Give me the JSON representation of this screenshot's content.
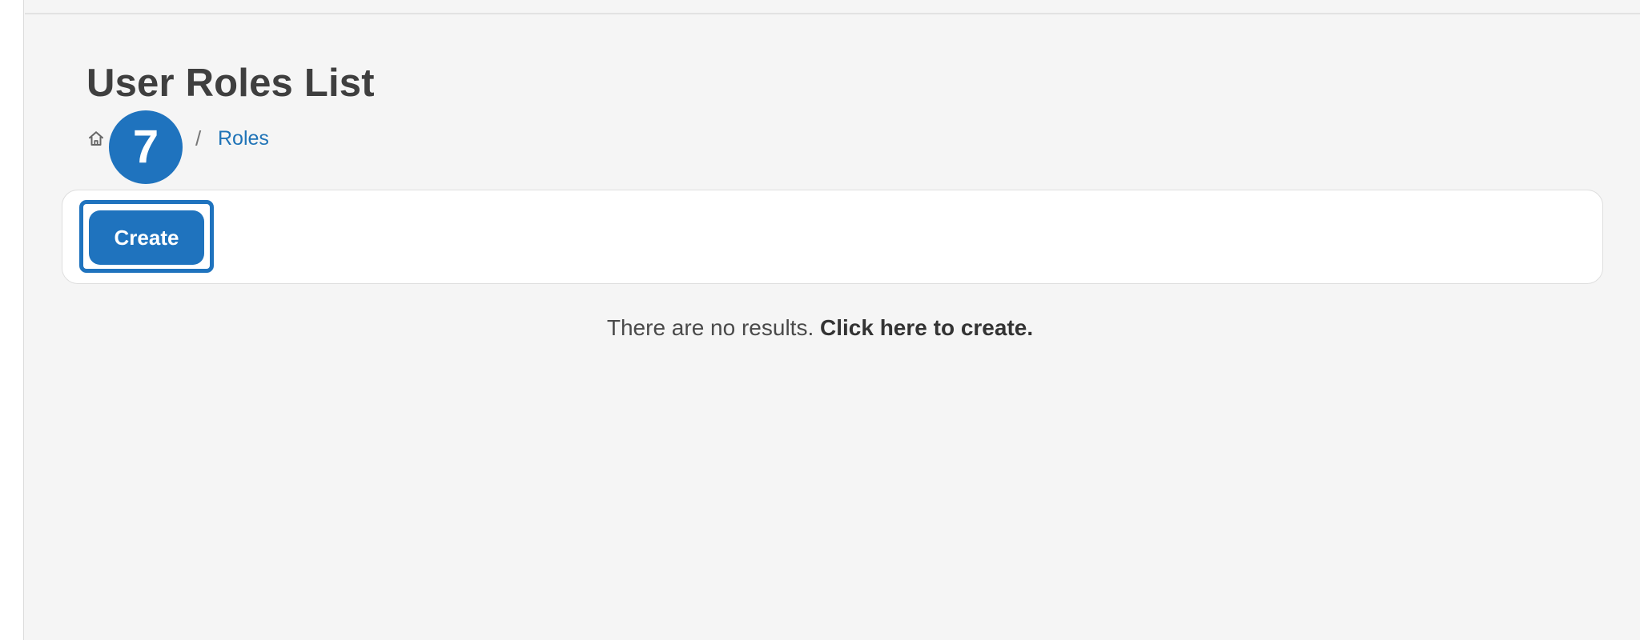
{
  "page": {
    "title": "User Roles List"
  },
  "breadcrumb": {
    "home_icon": "home-icon",
    "separator": "/",
    "current": "Roles"
  },
  "step_badge": {
    "number": "7",
    "color": "#1f73be"
  },
  "toolbar": {
    "create_label": "Create"
  },
  "empty_state": {
    "message": "There are no results.",
    "link_text": "Click here to create."
  },
  "colors": {
    "accent": "#1f73be",
    "background": "#f5f5f5",
    "card": "#ffffff",
    "text": "#444444"
  }
}
